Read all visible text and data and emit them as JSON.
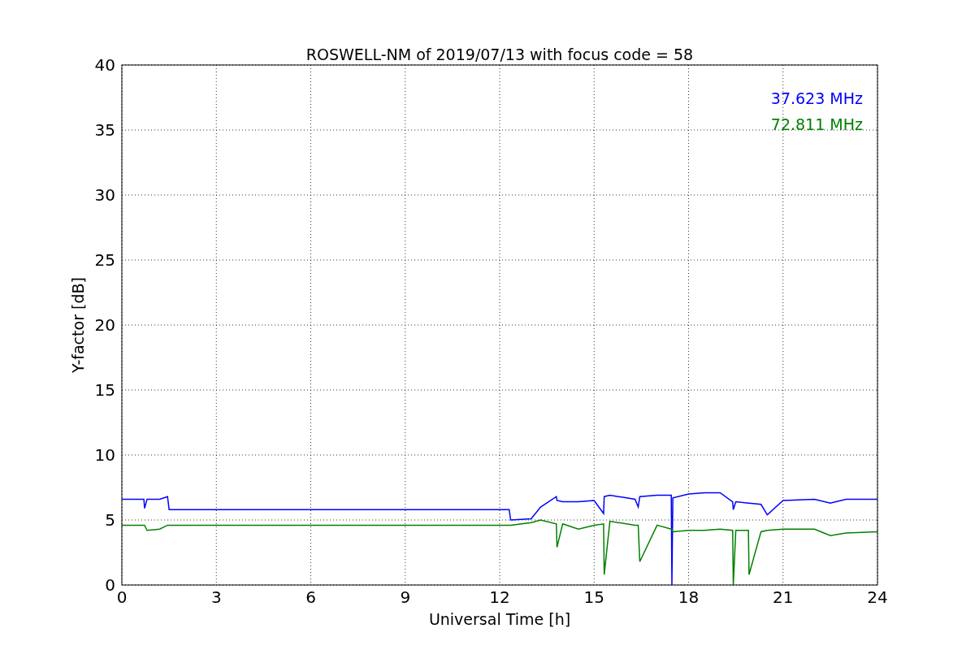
{
  "chart_data": {
    "type": "line",
    "title": "ROSWELL-NM of 2019/07/13 with focus code = 58",
    "xlabel": "Universal Time [h]",
    "ylabel": "Y-factor [dB]",
    "x": [
      0,
      0.7,
      0.72,
      0.8,
      1.2,
      1.45,
      1.5,
      12.3,
      12.35,
      13,
      13.3,
      13.8,
      13.82,
      14,
      14.5,
      15,
      15.3,
      15.32,
      15.5,
      16.3,
      16.4,
      16.45,
      17,
      17.45,
      17.47,
      17.5,
      18,
      18.5,
      19,
      19.4,
      19.42,
      19.5,
      19.9,
      19.92,
      20.3,
      20.5,
      21,
      22,
      22.5,
      23,
      24
    ],
    "series": [
      {
        "name": "37.623 MHz",
        "color": "#0000ff",
        "values": [
          6.6,
          6.6,
          5.9,
          6.6,
          6.6,
          6.8,
          5.8,
          5.8,
          5.0,
          5.1,
          6.0,
          6.8,
          6.5,
          6.4,
          6.4,
          6.5,
          5.5,
          6.8,
          6.9,
          6.6,
          6.0,
          6.8,
          6.9,
          6.9,
          0,
          6.7,
          7.0,
          7.1,
          7.1,
          6.4,
          5.8,
          6.4,
          6.3,
          6.3,
          6.2,
          5.4,
          6.5,
          6.6,
          6.3,
          6.6,
          6.6
        ]
      },
      {
        "name": "72.811 MHz",
        "color": "#008000",
        "values": [
          4.6,
          4.6,
          4.6,
          4.2,
          4.3,
          4.6,
          4.6,
          4.6,
          4.6,
          4.8,
          5.0,
          4.7,
          2.9,
          4.7,
          4.3,
          4.6,
          4.7,
          0.8,
          4.9,
          4.6,
          4.6,
          1.8,
          4.6,
          4.3,
          4.3,
          4.1,
          4.2,
          4.2,
          4.3,
          4.2,
          0,
          4.2,
          4.2,
          0.8,
          4.1,
          4.2,
          4.3,
          4.3,
          3.8,
          4.0,
          4.1
        ]
      }
    ],
    "xlim": [
      0,
      24
    ],
    "ylim": [
      0,
      40
    ],
    "xticks": [
      0,
      3,
      6,
      9,
      12,
      15,
      18,
      21,
      24
    ],
    "yticks": [
      0,
      5,
      10,
      15,
      20,
      25,
      30,
      35,
      40
    ],
    "grid": true
  }
}
